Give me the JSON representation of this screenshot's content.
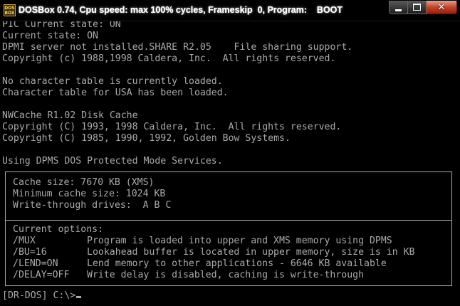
{
  "window": {
    "icon_text": "DOS BOX",
    "title": "DOSBox 0.74, Cpu speed: max 100% cycles, Frameskip  0, Program:    BOOT",
    "buttons": {
      "minimize": "minimize-icon",
      "maximize": "maximize-icon",
      "close": "close-icon"
    }
  },
  "colors": {
    "text": "#aaaaaa",
    "background": "#000000",
    "close_button": "#c4442a"
  },
  "console": {
    "lines": [
      "PIC Current state: ON",
      "Current state: ON",
      "DPMI server not installed.SHARE R2.05    File sharing support.",
      "Copyright (c) 1988,1998 Caldera, Inc.  All rights reserved.",
      "",
      "No character table is currently loaded.",
      "Character table for USA has been loaded.",
      "",
      "NWCache R1.02 Disk Cache",
      "Copyright (C) 1993, 1998 Caldera, Inc.  All rights reserved.",
      "Copyright (C) 1985, 1990, 1992, Golden Bow Systems.",
      "",
      "Using DPMS DOS Protected Mode Services."
    ],
    "cache_info": [
      "Cache size: 7670 KB (XMS)",
      "Minimum cache size: 1024 KB",
      "Write-through drives:  A B C"
    ],
    "options_header": "Current options:",
    "options": [
      {
        "flag": "/MUX",
        "desc": "Program is loaded into upper and XMS memory using DPMS"
      },
      {
        "flag": "/BU=16",
        "desc": "Lookahead buffer is located in upper memory, size is in KB"
      },
      {
        "flag": "/LEND=ON",
        "desc": "Lend memory to other applications - 6646 KB available"
      },
      {
        "flag": "/DELAY=OFF",
        "desc": "Write delay is disabled, caching is write-through"
      }
    ],
    "prompt": "[DR-DOS] C:\\>"
  }
}
